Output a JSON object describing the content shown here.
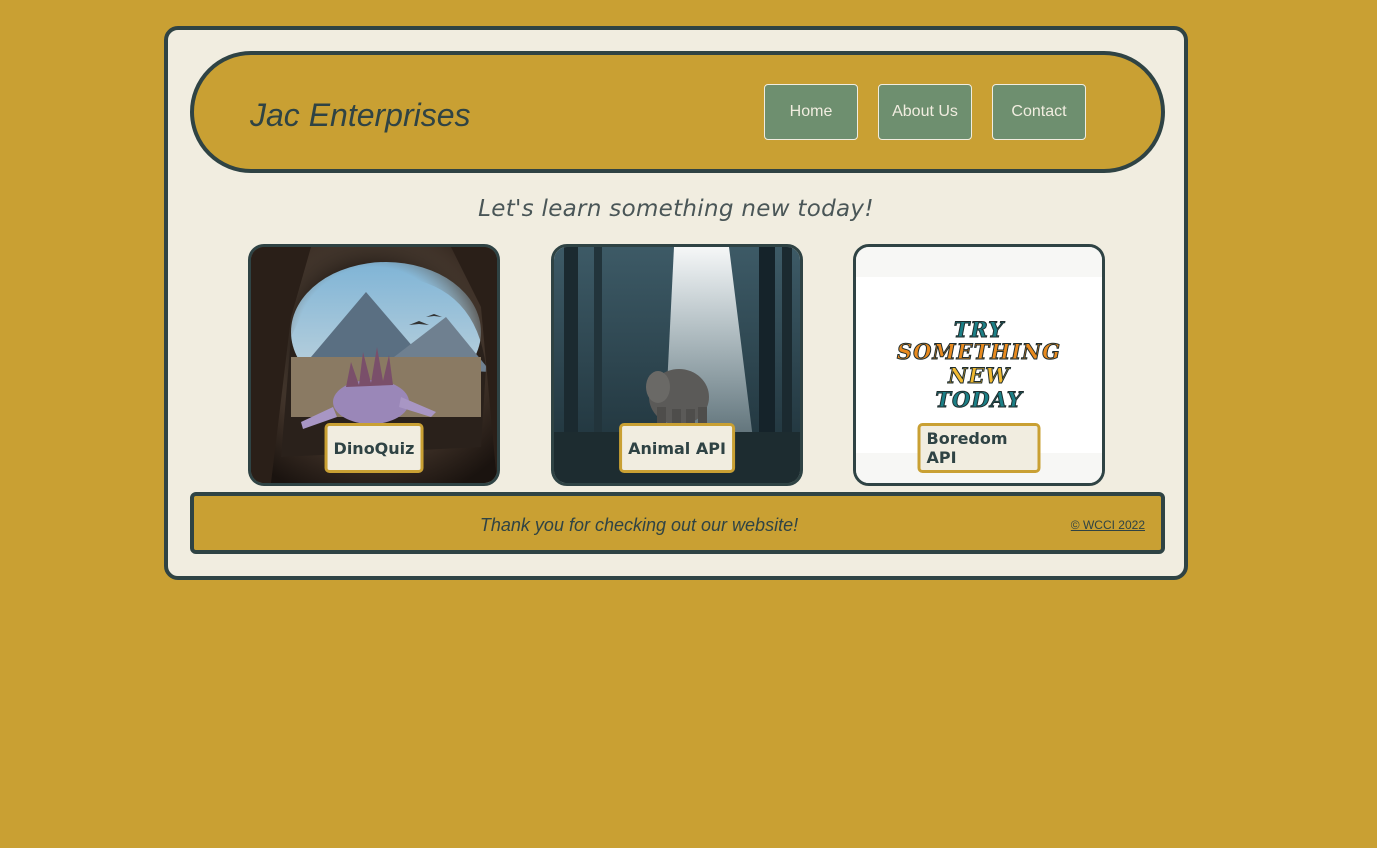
{
  "header": {
    "brand": "Jac Enterprises",
    "nav": [
      "Home",
      "About Us",
      "Contact"
    ]
  },
  "tagline": "Let's learn something new today!",
  "cards": [
    {
      "label": "DinoQuiz"
    },
    {
      "label": "Animal API"
    },
    {
      "label": "Boredom API",
      "art_text": [
        "TRY",
        "SOMETHING",
        "NEW",
        "TODAY"
      ]
    }
  ],
  "footer": {
    "text": "Thank you for checking out our website!",
    "copyright": "© WCCI 2022"
  },
  "colors": {
    "page_bg": "#c9a033",
    "panel_bg": "#f1ede0",
    "border": "#2f4344",
    "nav_button": "#6e8f6f"
  }
}
